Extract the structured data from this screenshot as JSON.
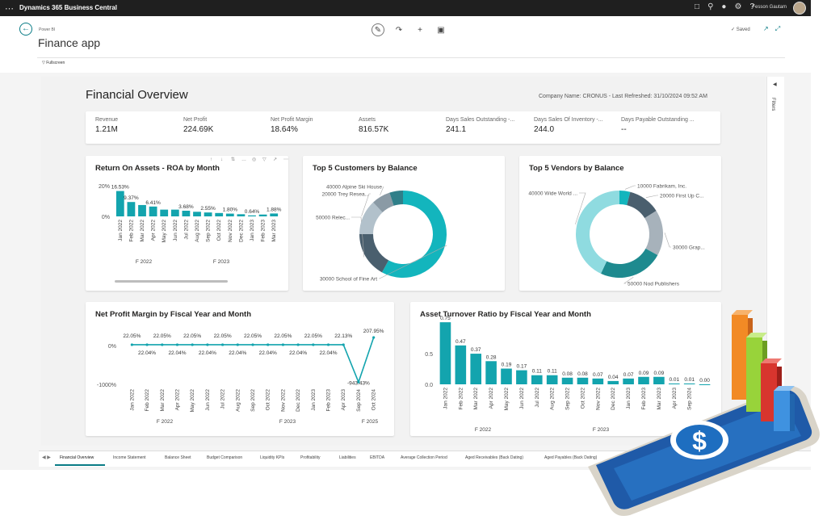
{
  "app": {
    "title": "Dynamics 365 Business Central",
    "user": "Fesson Gautam"
  },
  "header": {
    "breadcrumb": "Power BI",
    "title": "Finance app",
    "saved": "Saved",
    "fullscreen": "Fullscreen"
  },
  "filters": {
    "label": "Filters"
  },
  "dashboard": {
    "title": "Financial Overview",
    "company_line": "Company Name: CRONUS - Last Refreshed: 31/10/2024 09:52 AM"
  },
  "kpis": [
    {
      "label": "Revenue",
      "value": "1.21M"
    },
    {
      "label": "Net Profit",
      "value": "224.69K"
    },
    {
      "label": "Net Profit Margin",
      "value": "18.64%"
    },
    {
      "label": "Assets",
      "value": "816.57K"
    },
    {
      "label": "Days Sales Outstanding -...",
      "value": "241.1"
    },
    {
      "label": "Days Sales Of Inventory -...",
      "value": "244.0"
    },
    {
      "label": "Days Payable Outstanding ...",
      "value": "--"
    }
  ],
  "chart_data": [
    {
      "type": "bar",
      "title": "Return On Assets - ROA by Month",
      "yticks": [
        "20%",
        "0%"
      ],
      "ylim": [
        0,
        20
      ],
      "categories": [
        "Jan 2022",
        "Feb 2022",
        "Mar 2022",
        "Apr 2022",
        "May 2022",
        "Jun 2022",
        "Jul 2022",
        "Aug 2022",
        "Sep 2022",
        "Oct 2022",
        "Nov 2022",
        "Dec 2022",
        "Jan 2023",
        "Feb 2023",
        "Mar 2023"
      ],
      "values": [
        16.53,
        9.37,
        7.4,
        6.41,
        4.4,
        4.4,
        3.68,
        3.0,
        2.55,
        2.2,
        1.8,
        1.4,
        0.64,
        1.2,
        1.88
      ],
      "value_labels": [
        "16.53%",
        "9.37%",
        "",
        "6.41%",
        "",
        "",
        "3.68%",
        "",
        "2.55%",
        "",
        "1.80%",
        "",
        "0.64%",
        "",
        "1.88%"
      ],
      "group_labels": [
        "F 2022",
        "F 2023"
      ],
      "color": "#13a4ae"
    },
    {
      "type": "pie",
      "title": "Top 5 Customers by Balance",
      "slices": [
        {
          "label": "30000 School of Fine Art",
          "value": 58,
          "color": "#13b5bd"
        },
        {
          "label": "50000 Relec...",
          "value": 17,
          "color": "#4a5f6e"
        },
        {
          "label": "20000 Trey Resea...",
          "value": 13,
          "color": "#b2c1cb"
        },
        {
          "label": "40000 Alpine Ski House",
          "value": 7,
          "color": "#8a9aa5"
        },
        {
          "label": "",
          "value": 5,
          "color": "#2f7f89"
        }
      ]
    },
    {
      "type": "pie",
      "title": "Top 5 Vendors by Balance",
      "slices": [
        {
          "label": "10000 Fabrikam, Inc.",
          "value": 4,
          "color": "#13b5bd"
        },
        {
          "label": "20000 First Up C...",
          "value": 12,
          "color": "#4a5f6e"
        },
        {
          "label": "30000 Grap...",
          "value": 17,
          "color": "#a7b2bb"
        },
        {
          "label": "50000 Nod Publishers",
          "value": 24,
          "color": "#1e8a8f"
        },
        {
          "label": "40000 Wide World ...",
          "value": 43,
          "color": "#8fdbe0"
        }
      ]
    },
    {
      "type": "line",
      "title": "Net Profit Margin by Fiscal Year and Month",
      "yticks": [
        "0%",
        "-1000%"
      ],
      "ylim": [
        -1200,
        300
      ],
      "categories": [
        "Jan 2022",
        "Feb 2022",
        "Mar 2022",
        "Apr 2022",
        "May 2022",
        "Jun 2022",
        "Jul 2022",
        "Aug 2022",
        "Sep 2022",
        "Oct 2022",
        "Nov 2022",
        "Dec 2022",
        "Jan 2023",
        "Feb 2023",
        "Apr 2023",
        "Sep 2024",
        "Oct 2024"
      ],
      "values": [
        22.05,
        22.04,
        22.05,
        22.04,
        22.05,
        22.04,
        22.05,
        22.04,
        22.05,
        22.04,
        22.05,
        22.04,
        22.05,
        22.04,
        22.13,
        -943.43,
        207.95
      ],
      "value_labels": [
        "22.05%",
        "22.04%",
        "22.05%",
        "22.04%",
        "22.05%",
        "22.04%",
        "22.05%",
        "22.04%",
        "22.05%",
        "22.04%",
        "22.05%",
        "22.04%",
        "22.05%",
        "22.04%",
        "22.13%",
        "-943.43%",
        "207.95%"
      ],
      "group_labels": [
        "F 2022",
        "F 2023",
        "F 2025"
      ],
      "color": "#13a4ae"
    },
    {
      "type": "bar",
      "title": "Asset Turnover Ratio by Fiscal Year and Month",
      "yticks": [
        "0.5",
        "0.0"
      ],
      "ylim": [
        0,
        0.8
      ],
      "categories": [
        "Jan 2022",
        "Feb 2022",
        "Mar 2022",
        "Apr 2022",
        "May 2022",
        "Jun 2022",
        "Jul 2022",
        "Aug 2022",
        "Sep 2022",
        "Oct 2022",
        "Nov 2022",
        "Dec 2022",
        "Jan 2023",
        "Feb 2023",
        "Mar 2023",
        "Apr 2023",
        "Sep 2024"
      ],
      "values": [
        0.75,
        0.47,
        0.37,
        0.28,
        0.19,
        0.17,
        0.11,
        0.11,
        0.08,
        0.08,
        0.07,
        0.04,
        0.07,
        0.09,
        0.09,
        0.01,
        0.01,
        0.0
      ],
      "value_labels": [
        "0.75",
        "0.47",
        "0.37",
        "0.28",
        "0.19",
        "0.17",
        "0.11",
        "0.11",
        "0.08",
        "0.08",
        "0.07",
        "0.04",
        "0.07",
        "0.09",
        "0.09",
        "0.01",
        "0.01",
        "0.00"
      ],
      "group_labels": [
        "F 2022",
        "F 2023"
      ],
      "color": "#13a4ae"
    }
  ],
  "tabs": [
    "Financial Overview",
    "Income Statement",
    "Balance Sheet",
    "Budget Comparison",
    "Liquidity KPIs",
    "Profitability",
    "Liabilities",
    "EBITDA",
    "Average Collection Period",
    "Aged Receivables (Back Dating)",
    "Aged Payables (Back Dating)"
  ],
  "colors": {
    "accent": "#13a4ae",
    "topbar": "#1f1f1f"
  }
}
